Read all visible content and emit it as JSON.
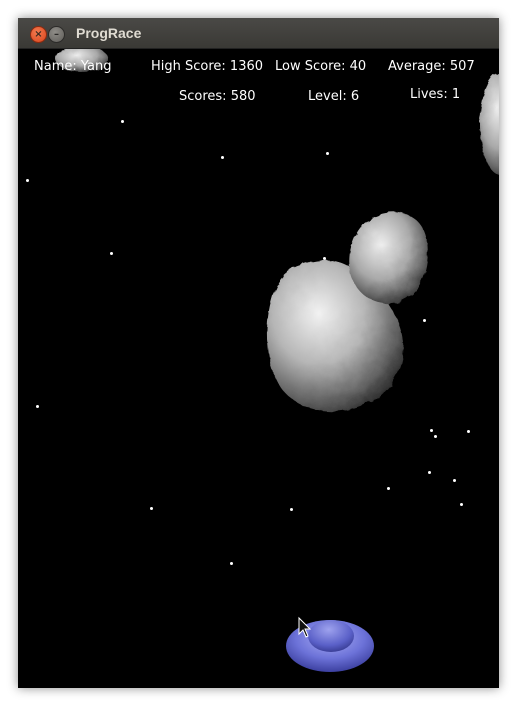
{
  "window": {
    "title": "ProgRace",
    "close_glyph": "×",
    "minimize_glyph": "–"
  },
  "hud": {
    "name": "Name: Yang",
    "high_score": "High Score: 1360",
    "low_score": "Low Score: 40",
    "average": "Average: 507",
    "scores": "Scores: 580",
    "level": "Level: 6",
    "lives": "Lives: 1"
  },
  "icons": {
    "close": "close-icon",
    "minimize": "minimize-icon",
    "cursor": "mouse-pointer-icon"
  },
  "colors": {
    "background": "#000000",
    "titlebar": "#3c3b37",
    "hud_text": "#ffffff",
    "ship": "#6c72d8",
    "asteroid": "#b8b8b8"
  }
}
